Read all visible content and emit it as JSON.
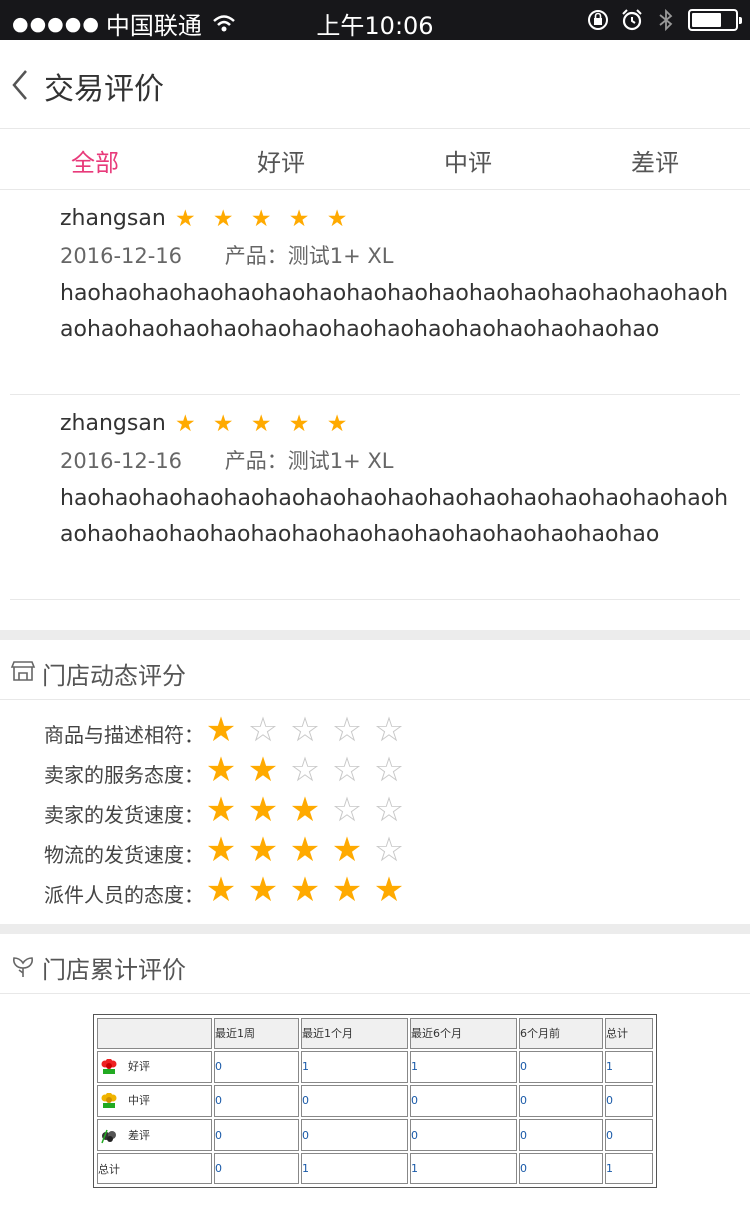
{
  "status": {
    "signal": "●●●●●",
    "carrier": "中国联通",
    "time": "上午10:06",
    "battery_level": 0.7
  },
  "nav": {
    "title": "交易评价"
  },
  "tabs": [
    {
      "label": "全部",
      "active": true
    },
    {
      "label": "好评",
      "active": false
    },
    {
      "label": "中评",
      "active": false
    },
    {
      "label": "差评",
      "active": false
    }
  ],
  "reviews": [
    {
      "user": "zhangsan",
      "stars": "★ ★ ★ ★ ★",
      "date": "2016-12-16",
      "product": "产品：测试1+ XL",
      "content": "haohaohaohaohaohaohaohaohaohaohaohaohaohaohaohaohaohaohaohaohaohaohaohaohaohaohaohaohaohaohao"
    },
    {
      "user": "zhangsan",
      "stars": "★ ★ ★ ★ ★",
      "date": "2016-12-16",
      "product": "产品：测试1+ XL",
      "content": "haohaohaohaohaohaohaohaohaohaohaohaohaohaohaohaohaohaohaohaohaohaohaohaohaohaohaohaohaohaohao"
    }
  ],
  "store_rating": {
    "title": "门店动态评分",
    "rows": [
      {
        "label": "商品与描述相符：",
        "stars": 1
      },
      {
        "label": "卖家的服务态度：",
        "stars": 2
      },
      {
        "label": "卖家的发货速度：",
        "stars": 3
      },
      {
        "label": "物流的发货速度：",
        "stars": 4
      },
      {
        "label": "派件人员的态度：",
        "stars": 5
      }
    ],
    "max_stars": 5
  },
  "store_cumulative": {
    "title": "门店累计评价",
    "headers": [
      "",
      "最近1周",
      "最近1个月",
      "最近6个月",
      "6个月前",
      "总计"
    ],
    "rows": [
      {
        "label": "好评",
        "icon": "red-flower-icon",
        "values": [
          "0",
          "1",
          "1",
          "0",
          "1"
        ]
      },
      {
        "label": "中评",
        "icon": "yellow-flower-icon",
        "values": [
          "0",
          "0",
          "0",
          "0",
          "0"
        ]
      },
      {
        "label": "差评",
        "icon": "dark-flower-icon",
        "values": [
          "0",
          "0",
          "0",
          "0",
          "0"
        ]
      },
      {
        "label": "总计",
        "icon": "",
        "values": [
          "0",
          "1",
          "1",
          "0",
          "1"
        ]
      }
    ]
  },
  "colors": {
    "accent": "#e83a7a",
    "star": "#ffaa00",
    "star_off": "#c8c8c8"
  }
}
